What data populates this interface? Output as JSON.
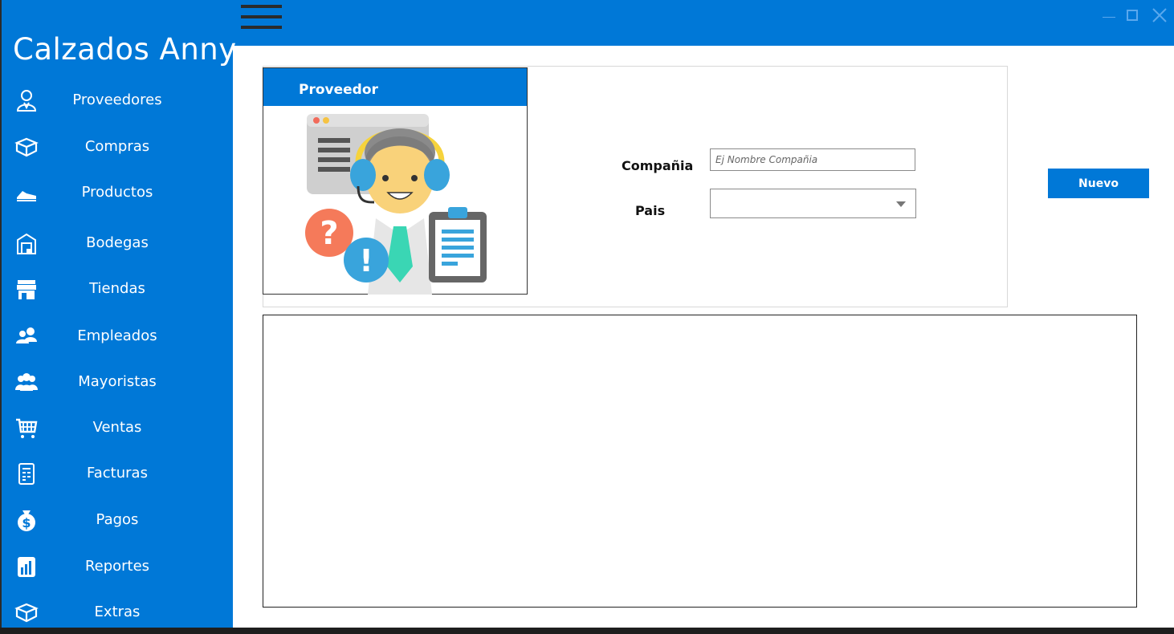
{
  "app": {
    "title": "Calzados Anny"
  },
  "sidebar": {
    "items": [
      {
        "label": "Proveedores",
        "icon": "supplier-icon"
      },
      {
        "label": "Compras",
        "icon": "box-icon"
      },
      {
        "label": "Productos",
        "icon": "shoe-icon"
      },
      {
        "label": "Bodegas",
        "icon": "warehouse-icon"
      },
      {
        "label": "Tiendas",
        "icon": "store-icon"
      },
      {
        "label": "Empleados",
        "icon": "employees-icon"
      },
      {
        "label": "Mayoristas",
        "icon": "wholesalers-icon"
      },
      {
        "label": "Ventas",
        "icon": "cart-icon"
      },
      {
        "label": "Facturas",
        "icon": "invoice-icon"
      },
      {
        "label": "Pagos",
        "icon": "money-bag-icon"
      },
      {
        "label": "Reportes",
        "icon": "reports-icon"
      },
      {
        "label": "Extras",
        "icon": "box-icon"
      }
    ]
  },
  "form": {
    "card_title": "Proveedor",
    "company_label": "Compañia",
    "company_placeholder": "Ej Nombre Compañia",
    "company_value": "",
    "country_label": "Pais",
    "country_value": "",
    "new_button": "Nuevo"
  },
  "colors": {
    "accent": "#0078d7",
    "background": "#ffffff"
  }
}
